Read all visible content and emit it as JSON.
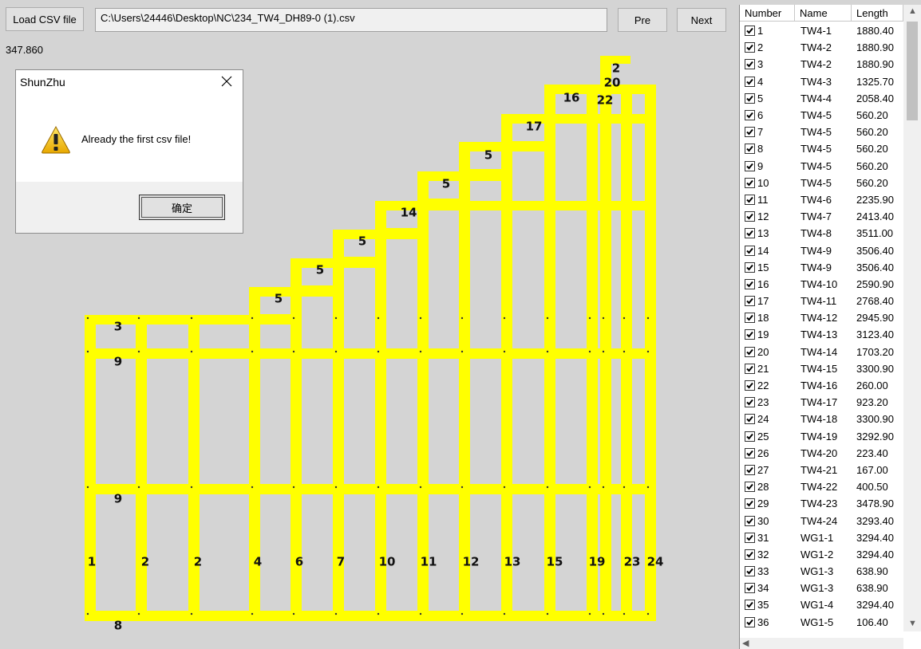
{
  "toolbar": {
    "load_label": "Load CSV file",
    "path_value": "C:\\Users\\24446\\Desktop\\NC\\234_TW4_DH89-0 (1).csv",
    "prev_label": "Pre",
    "next_label": "Next"
  },
  "value_label": "347.860",
  "dialog": {
    "title": "ShunZhu",
    "message": "Already the first csv file!",
    "ok_label": "确定",
    "icon": "warning-icon"
  },
  "drawing": {
    "fill_color": "#ffff00",
    "background": "#d4d4d4",
    "member_labels": [
      "1",
      "2",
      "2",
      "4",
      "6",
      "7",
      "10",
      "11",
      "12",
      "13",
      "15",
      "19",
      "23",
      "24",
      "3",
      "9",
      "9",
      "8",
      "5",
      "5",
      "5",
      "14",
      "5",
      "5",
      "17",
      "16",
      "22",
      "20",
      "2"
    ]
  },
  "table": {
    "columns": [
      "Number",
      "Name",
      "Length"
    ],
    "rows": [
      {
        "n": "1",
        "name": "TW4-1",
        "len": "1880.40"
      },
      {
        "n": "2",
        "name": "TW4-2",
        "len": "1880.90"
      },
      {
        "n": "3",
        "name": "TW4-2",
        "len": "1880.90"
      },
      {
        "n": "4",
        "name": "TW4-3",
        "len": "1325.70"
      },
      {
        "n": "5",
        "name": "TW4-4",
        "len": "2058.40"
      },
      {
        "n": "6",
        "name": "TW4-5",
        "len": "560.20"
      },
      {
        "n": "7",
        "name": "TW4-5",
        "len": "560.20"
      },
      {
        "n": "8",
        "name": "TW4-5",
        "len": "560.20"
      },
      {
        "n": "9",
        "name": "TW4-5",
        "len": "560.20"
      },
      {
        "n": "10",
        "name": "TW4-5",
        "len": "560.20"
      },
      {
        "n": "11",
        "name": "TW4-6",
        "len": "2235.90"
      },
      {
        "n": "12",
        "name": "TW4-7",
        "len": "2413.40"
      },
      {
        "n": "13",
        "name": "TW4-8",
        "len": "3511.00"
      },
      {
        "n": "14",
        "name": "TW4-9",
        "len": "3506.40"
      },
      {
        "n": "15",
        "name": "TW4-9",
        "len": "3506.40"
      },
      {
        "n": "16",
        "name": "TW4-10",
        "len": "2590.90"
      },
      {
        "n": "17",
        "name": "TW4-11",
        "len": "2768.40"
      },
      {
        "n": "18",
        "name": "TW4-12",
        "len": "2945.90"
      },
      {
        "n": "19",
        "name": "TW4-13",
        "len": "3123.40"
      },
      {
        "n": "20",
        "name": "TW4-14",
        "len": "1703.20"
      },
      {
        "n": "21",
        "name": "TW4-15",
        "len": "3300.90"
      },
      {
        "n": "22",
        "name": "TW4-16",
        "len": "260.00"
      },
      {
        "n": "23",
        "name": "TW4-17",
        "len": "923.20"
      },
      {
        "n": "24",
        "name": "TW4-18",
        "len": "3300.90"
      },
      {
        "n": "25",
        "name": "TW4-19",
        "len": "3292.90"
      },
      {
        "n": "26",
        "name": "TW4-20",
        "len": "223.40"
      },
      {
        "n": "27",
        "name": "TW4-21",
        "len": "167.00"
      },
      {
        "n": "28",
        "name": "TW4-22",
        "len": "400.50"
      },
      {
        "n": "29",
        "name": "TW4-23",
        "len": "3478.90"
      },
      {
        "n": "30",
        "name": "TW4-24",
        "len": "3293.40"
      },
      {
        "n": "31",
        "name": "WG1-1",
        "len": "3294.40"
      },
      {
        "n": "32",
        "name": "WG1-2",
        "len": "3294.40"
      },
      {
        "n": "33",
        "name": "WG1-3",
        "len": "638.90"
      },
      {
        "n": "34",
        "name": "WG1-3",
        "len": "638.90"
      },
      {
        "n": "35",
        "name": "WG1-4",
        "len": "3294.40"
      },
      {
        "n": "36",
        "name": "WG1-5",
        "len": "106.40"
      }
    ]
  }
}
